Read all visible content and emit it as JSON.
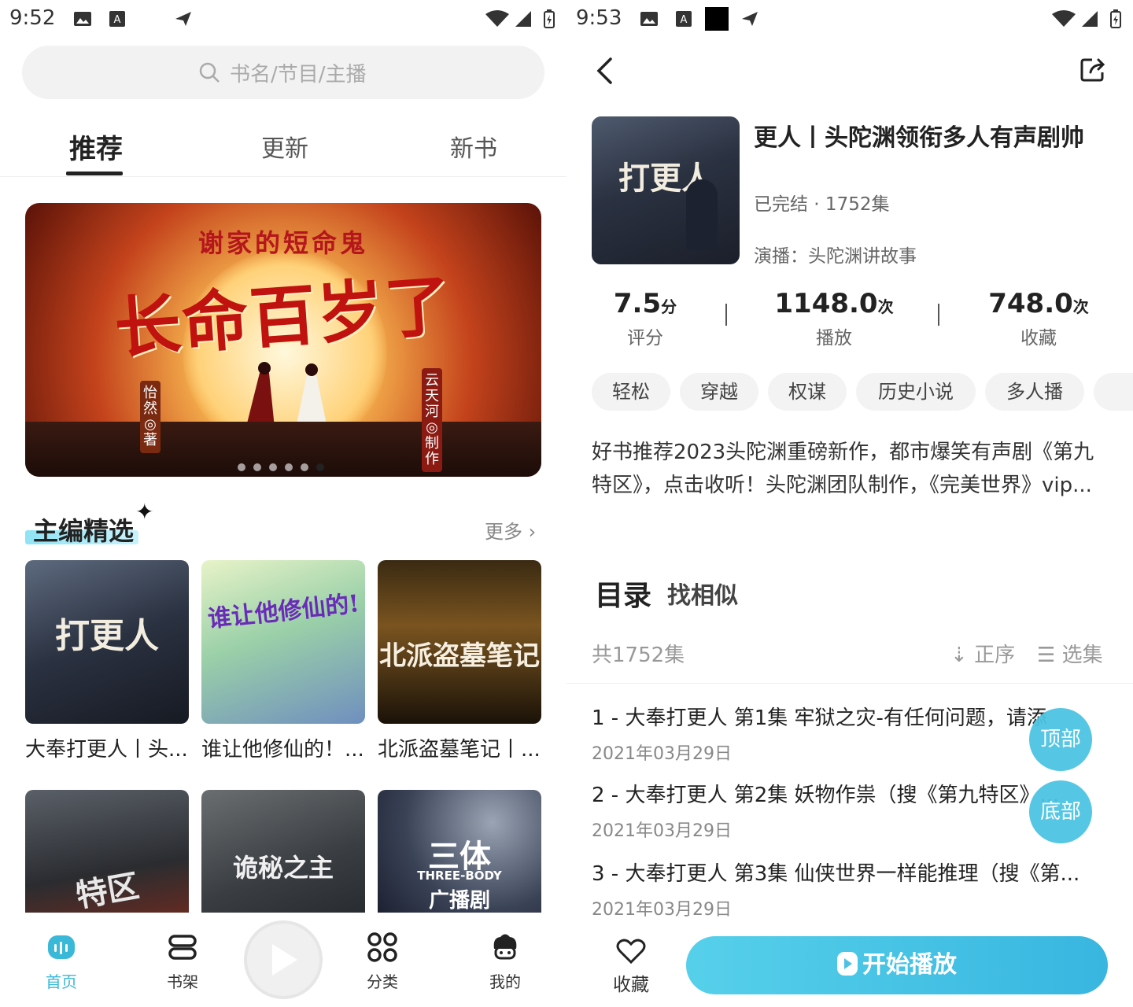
{
  "left": {
    "status": {
      "time": "9:52"
    },
    "search": {
      "placeholder": "书名/节目/主播"
    },
    "tabs": [
      {
        "label": "推荐"
      },
      {
        "label": "更新"
      },
      {
        "label": "新书"
      }
    ],
    "banner": {
      "subtitle": "谢家的短命鬼",
      "title": "长命百岁了",
      "author_tag": "怡然◎著",
      "producer_tag": "云天河◎制作",
      "page_count": 6,
      "active_page": 6
    },
    "section": {
      "title": "主编精选",
      "more": "更多"
    },
    "books": [
      {
        "caption": "大奉打更人丨头...",
        "cover_text": "打更人"
      },
      {
        "caption": "谁让他修仙的！...",
        "cover_text": "谁让他修仙的!"
      },
      {
        "caption": "北派盗墓笔记丨...",
        "cover_text": "北派盗墓笔记"
      },
      {
        "caption": "",
        "cover_text": "特区"
      },
      {
        "caption": "",
        "cover_text": "诡秘之主"
      },
      {
        "caption": "",
        "cover_text": "三体",
        "cover_sub": "THREE-BODY",
        "cover_sub2": "广播剧"
      }
    ],
    "nav": [
      {
        "label": "首页",
        "icon": "home-icon",
        "active": true
      },
      {
        "label": "书架",
        "icon": "bookshelf-icon",
        "active": false
      },
      {
        "label": "",
        "icon": "play-center-icon",
        "active": false
      },
      {
        "label": "分类",
        "icon": "category-icon",
        "active": false
      },
      {
        "label": "我的",
        "icon": "profile-icon",
        "active": false
      }
    ],
    "colors": {
      "accent": "#3ab8d8"
    }
  },
  "right": {
    "status": {
      "time": "9:53"
    },
    "book": {
      "title": "更人丨头陀渊领衔多人有声剧帅",
      "status": "已完结 · 1752集",
      "cast": "演播：头陀渊讲故事",
      "cover_text": "打更人"
    },
    "stats": [
      {
        "value": "7.5",
        "unit": "分",
        "label": "评分"
      },
      {
        "value": "1148.0",
        "unit": "次",
        "label": "播放"
      },
      {
        "value": "748.0",
        "unit": "次",
        "label": "收藏"
      }
    ],
    "tags": [
      "轻松",
      "穿越",
      "权谋",
      "历史小说",
      "多人播"
    ],
    "description": "好书推荐2023头陀渊重磅新作，都市爆笑有声剧《第九特区》，点击收听！头陀渊团队制作，《完美世界》vip...",
    "toc": {
      "title": "目录",
      "similar": "找相似",
      "count": "共1752集",
      "order": "正序",
      "pick": "选集"
    },
    "episodes": [
      {
        "title": "1 - 大奉打更人 第1集 牢狱之灾-有任何问题，请添",
        "date": "2021年03月29日"
      },
      {
        "title": "2 - 大奉打更人 第2集 妖物作祟（搜《第九特区》...",
        "date": "2021年03月29日"
      },
      {
        "title": "3 - 大奉打更人 第3集 仙侠世界一样能推理（搜《第...",
        "date": "2021年03月29日"
      }
    ],
    "fab": {
      "top": "顶部",
      "bottom": "底部"
    },
    "bottom": {
      "fav": "收藏",
      "play": "开始播放"
    },
    "colors": {
      "accent": "#4cc3e3"
    }
  }
}
